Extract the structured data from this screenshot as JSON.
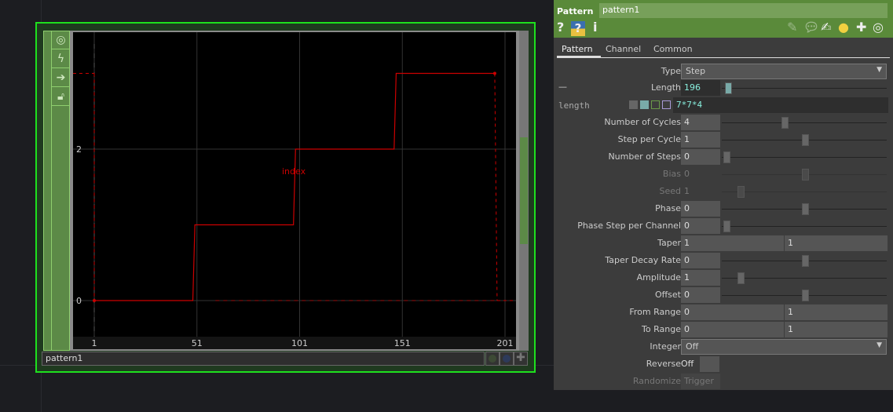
{
  "node": {
    "name": "pattern1",
    "sidebar_icons": [
      "viewer-icon",
      "bolt-icon",
      "arrow-icon",
      "lock-icon"
    ]
  },
  "chart_data": {
    "type": "line",
    "channel": "index",
    "x": [
      1,
      49,
      50,
      98,
      99,
      147,
      148,
      196
    ],
    "y": [
      0,
      0,
      1,
      1,
      2,
      2,
      3,
      3
    ],
    "xlim": [
      1,
      201
    ],
    "ylim": [
      0,
      3
    ],
    "xticks": [
      "1",
      "51",
      "101",
      "151",
      "201"
    ],
    "yticks": [
      "0",
      "2"
    ],
    "color": "#cc0000"
  },
  "panel": {
    "op_type": "Pattern",
    "op_name": "pattern1",
    "tabs": [
      "Pattern",
      "Channel",
      "Common"
    ],
    "type": {
      "label": "Type",
      "value": "Step"
    },
    "length": {
      "label": "Length",
      "value": "196",
      "expr_label": "length",
      "expr": "7*7*4",
      "dash": "—"
    },
    "params": [
      {
        "label": "Number of Cycles",
        "value": "4",
        "slider": 0.37
      },
      {
        "label": "Step per Cycle",
        "value": "1",
        "slider": 0.5
      },
      {
        "label": "Number of Steps",
        "value": "0",
        "slider": 0
      },
      {
        "label": "Bias",
        "value": "0",
        "slider": 0.5,
        "disabled": true
      },
      {
        "label": "Seed",
        "value": "1",
        "slider": 0.09,
        "disabled": true
      },
      {
        "label": "Phase",
        "value": "0",
        "slider": 0.5
      },
      {
        "label": "Phase Step per Channel",
        "value": "0",
        "slider": 0
      }
    ],
    "taper": {
      "label": "Taper",
      "v1": "1",
      "v2": "1"
    },
    "params2": [
      {
        "label": "Taper Decay Rate",
        "value": "0",
        "slider": 0.5
      },
      {
        "label": "Amplitude",
        "value": "1",
        "slider": 0.09
      },
      {
        "label": "Offset",
        "value": "0",
        "slider": 0.5
      }
    ],
    "from_range": {
      "label": "From Range",
      "v1": "0",
      "v2": "1"
    },
    "to_range": {
      "label": "To Range",
      "v1": "0",
      "v2": "1"
    },
    "integer": {
      "label": "Integer",
      "value": "Off"
    },
    "reverse": {
      "label": "Reverse",
      "value": "Off"
    },
    "randomize": {
      "label": "Randomize",
      "button": "Trigger"
    }
  }
}
